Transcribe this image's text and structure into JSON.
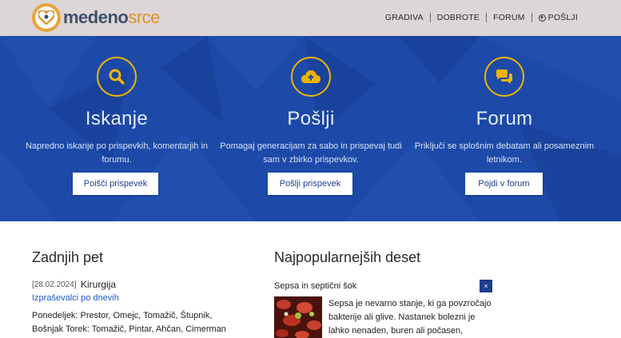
{
  "header": {
    "logo": {
      "part1": "medeno",
      "part2": "srce"
    },
    "nav": [
      {
        "label": "GRADIVA"
      },
      {
        "label": "DOBROTE"
      },
      {
        "label": "FORUM"
      },
      {
        "label": "POŠLJI"
      }
    ]
  },
  "features": [
    {
      "title": "Iskanje",
      "text": "Napredno iskanje po prispevkih, komentarjih in forumu.",
      "button": "Poišči prispevek",
      "icon": "search-icon"
    },
    {
      "title": "Pošlji",
      "text": "Pomagaj generacijam za sabo in prispevaj tudi sam v zbirko prispevkov.",
      "button": "Pošlji prispevek",
      "icon": "cloud-upload-icon"
    },
    {
      "title": "Forum",
      "text": "Priključi se splošnim debatam ali posameznim letnikom.",
      "button": "Pojdi v forum",
      "icon": "chat-bubbles-icon"
    }
  ],
  "recent": {
    "heading": "Zadnjih pet",
    "item": {
      "date": "[28.02.2024]",
      "title": "Kirurgija",
      "subtitle": "Izpraševalci po dnevih",
      "text": "Ponedeljek: Prestor, Omejc, Tomažič, Štupnik, Bošnjak Torek: Tomažič, Pintar, Ahčan, Cimerman Sreda: Snoj,"
    }
  },
  "popular": {
    "heading": "Najpopularnejših deset",
    "item": {
      "title": "Sepsa in septični šok",
      "close": "×",
      "text": "Sepsa je nevarno stanje, ki ga povzročajo bakterije ali glive. Nastanek bolezni je lahko nenaden, buren ali počasen, odvisen od"
    }
  },
  "colors": {
    "hero": "#1d4aa8",
    "accent": "#f0b400",
    "header": "#ddd6d6",
    "link": "#1e5bc6"
  }
}
